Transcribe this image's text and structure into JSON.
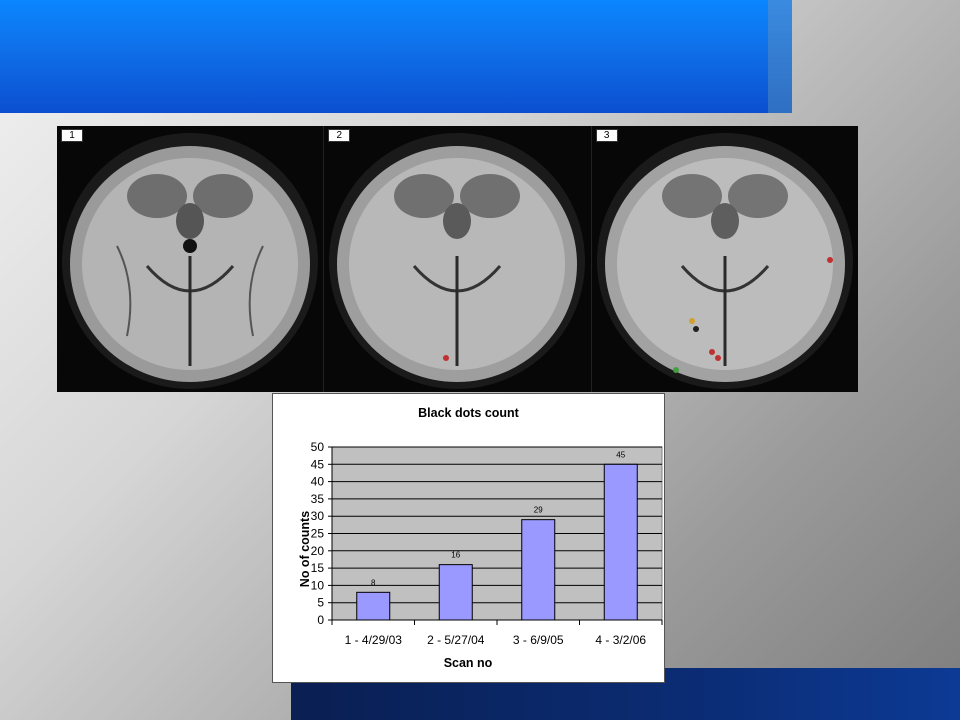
{
  "slide": {
    "colors": {
      "header_band": "#0b6fe8",
      "footer_band": "#0b2c74",
      "plot_bg": "#c0c0c0",
      "bar_fill": "#9999ff"
    }
  },
  "scans": [
    {
      "label": "1"
    },
    {
      "label": "2"
    },
    {
      "label": "3"
    }
  ],
  "chart_data": {
    "type": "bar",
    "title": "Black dots count",
    "xlabel": "Scan no",
    "ylabel": "No of counts",
    "categories": [
      "1 - 4/29/03",
      "2 - 5/27/04",
      "3 - 6/9/05",
      "4 - 3/2/06"
    ],
    "values": [
      8,
      16,
      29,
      45
    ],
    "data_labels": [
      "8",
      "16",
      "29",
      "45"
    ],
    "ylim": [
      0,
      50
    ],
    "yticks": [
      0,
      5,
      10,
      15,
      20,
      25,
      30,
      35,
      40,
      45,
      50
    ],
    "grid": true,
    "legend": "none"
  }
}
